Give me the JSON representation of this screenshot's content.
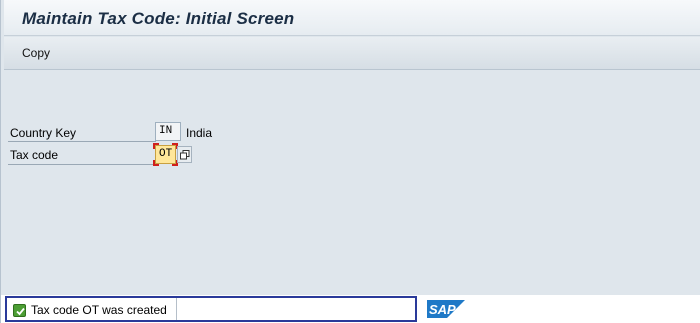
{
  "window": {
    "title": "Maintain Tax Code: Initial Screen"
  },
  "toolbar": {
    "copy_label": "Copy"
  },
  "form": {
    "country_key": {
      "label": "Country Key",
      "value": "IN",
      "description": "India"
    },
    "tax_code": {
      "label": "Tax code",
      "value": "OT"
    }
  },
  "status": {
    "message": "Tax code OT was created",
    "type": "success",
    "color": "#4c9e34"
  },
  "branding": {
    "logo_text": "SAP",
    "logo_color": "#1f79c7"
  }
}
